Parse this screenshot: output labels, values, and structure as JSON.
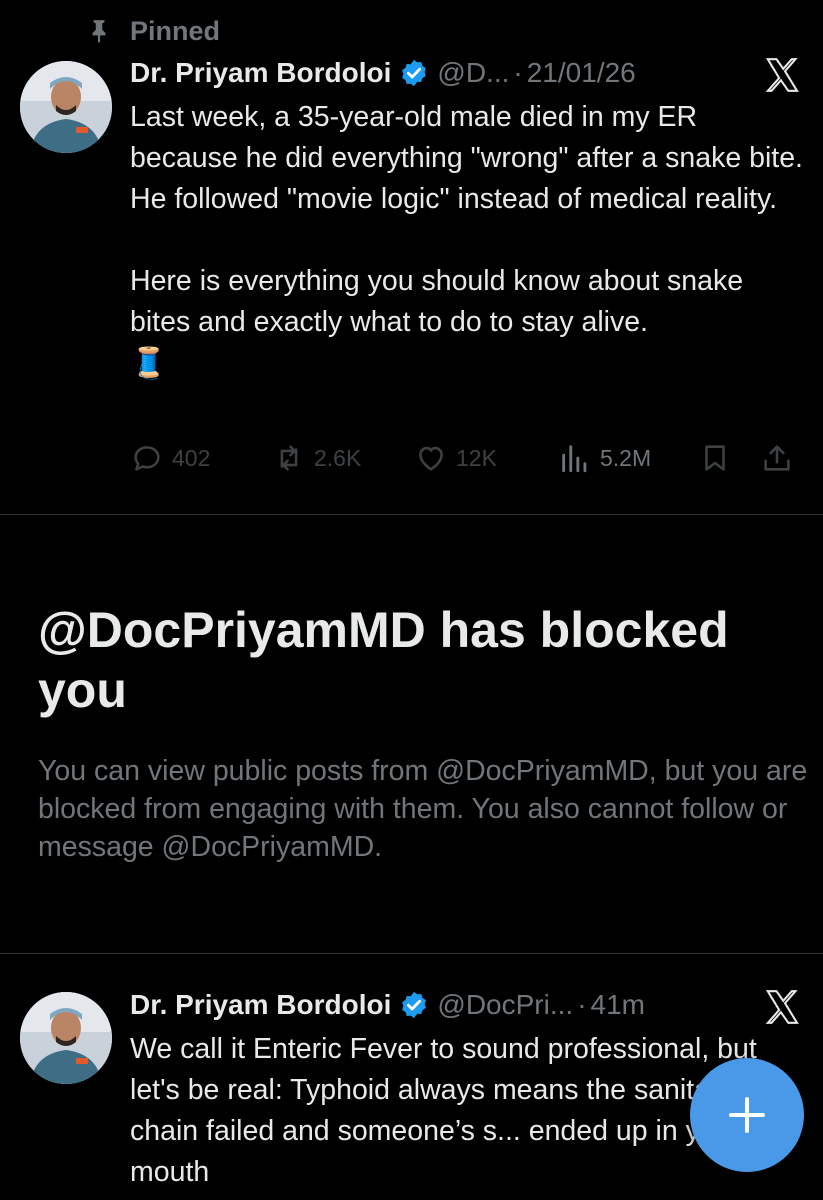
{
  "pinned": {
    "label": "Pinned"
  },
  "pinned_post": {
    "author": "Dr. Priyam Bordoloi",
    "handle": "@D...",
    "dot": "·",
    "timestamp": "21/01/26",
    "paragraph1": "Last week, a 35-year-old male died in my ER because he did everything \"wrong\" after a snake bite. He followed \"movie logic\" instead of medical reality.",
    "paragraph2": "Here is everything you should know about snake bites and exactly what to do to stay alive.",
    "emoji": "🧵",
    "replies": "402",
    "reposts": "2.6K",
    "likes": "12K",
    "views": "5.2M"
  },
  "blocked": {
    "title": "@DocPriyamMD has blocked you",
    "body": "You can view public posts from @DocPriyamMD, but you are blocked from engaging with them. You also cannot follow or message @DocPriyamMD."
  },
  "second_post": {
    "author": "Dr. Priyam Bordoloi",
    "handle": "@DocPri...",
    "dot": "·",
    "timestamp": "41m",
    "text": "We call it Enteric Fever to sound professional, but let's be real: Typhoid always means the sanitation chain failed and someone’s s... ended up in your mouth"
  },
  "icons": {
    "pin": "pin-icon",
    "verified": "verified-badge-icon",
    "x": "x-logo-icon",
    "reply": "reply-icon",
    "repost": "repost-icon",
    "like": "like-icon",
    "views": "views-icon",
    "bookmark": "bookmark-icon",
    "share": "share-icon",
    "compose": "plus-icon"
  },
  "colors": {
    "background": "#000000",
    "text": "#e7e9ea",
    "muted": "#71767b",
    "disabled": "#3e4144",
    "accent": "#4a99e9",
    "verified": "#1d9bf0"
  }
}
